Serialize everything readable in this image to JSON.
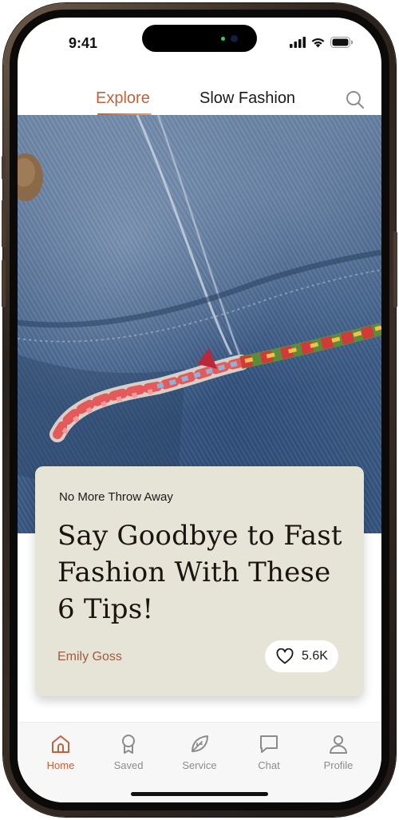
{
  "status_bar": {
    "time": "9:41",
    "icons": [
      "cellular-signal-icon",
      "wifi-icon",
      "battery-icon"
    ]
  },
  "top_nav": {
    "tabs": [
      {
        "label": "Explore",
        "active": true
      },
      {
        "label": "Slow Fashion",
        "active": false
      }
    ],
    "search_icon": "search-icon"
  },
  "hero": {
    "subject": "denim-jacket-with-colorful-embroidered-hem"
  },
  "article": {
    "kicker": "No More Throw Away",
    "title": "Say Goodbye to Fast Fashion With These 6 Tips!",
    "author": "Emily Goss",
    "likes": "5.6K",
    "like_icon": "heart-outline-icon"
  },
  "bottom_nav": {
    "items": [
      {
        "label": "Home",
        "icon": "home-icon",
        "active": true
      },
      {
        "label": "Saved",
        "icon": "award-badge-icon",
        "active": false
      },
      {
        "label": "Service",
        "icon": "leaf-icon",
        "active": false
      },
      {
        "label": "Chat",
        "icon": "chat-bubble-icon",
        "active": false
      },
      {
        "label": "Profile",
        "icon": "user-icon",
        "active": false
      }
    ]
  },
  "colors": {
    "accent": "#c2613a",
    "card_background": "#e6e4d6",
    "author": "#a35a3f",
    "inactive_nav": "#8c8c8c"
  }
}
